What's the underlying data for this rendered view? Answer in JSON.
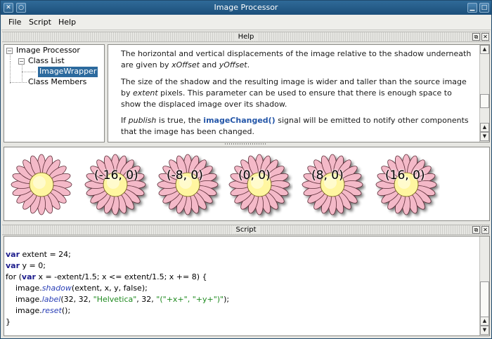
{
  "window": {
    "title": "Image Processor"
  },
  "menu": {
    "file": "File",
    "script": "Script",
    "help": "Help"
  },
  "help_dock": {
    "title": "Help",
    "tree": {
      "root": "Image Processor",
      "class_list": "Class List",
      "selected": "ImageWrapper",
      "class_members": "Class Members"
    },
    "paragraphs": {
      "p1_a": "The horizontal and vertical displacements of the image relative to the shadow underneath are given by ",
      "p1_x": "xOffset",
      "p1_and": " and ",
      "p1_y": "yOffset",
      "p1_end": ".",
      "p2_a": "The size of the shadow and the resulting image is wider and taller than the source image by ",
      "p2_ext": "extent",
      "p2_b": " pixels. This parameter can be used to ensure that there is enough space to show the displaced image over its shadow.",
      "p3_a": "If ",
      "p3_pub": "publish",
      "p3_b": " is true, the ",
      "p3_link": "imageChanged()",
      "p3_c": " signal will be emitted to notify other components that the image has been changed."
    }
  },
  "images": {
    "labels": [
      "(-16, 0)",
      "(-8, 0)",
      "(0, 0)",
      "(8, 0)",
      "(16, 0)"
    ],
    "petal_color": "#f4b9c8",
    "center_color": "#fff6a0"
  },
  "script_dock": {
    "title": "Script",
    "lines": {
      "l1_kw": "var",
      "l1_rest": " extent = 24;",
      "l2_kw": "var",
      "l2_rest": " y = 0;",
      "l3_a": "for (",
      "l3_kw": "var",
      "l3_rest": " x = -extent/1.5; x <= extent/1.5; x += 8) {",
      "l4_a": "    image.",
      "l4_fn": "shadow",
      "l4_b": "(extent, x, y, false);",
      "l5_a": "    image.",
      "l5_fn": "label",
      "l5_b": "(32, 32, ",
      "l5_str1": "\"Helvetica\"",
      "l5_c": ", 32, ",
      "l5_str2": "\"(\"+x+\", \"+y+\")\"",
      "l5_d": ");",
      "l6_a": "    image.",
      "l6_fn": "reset",
      "l6_b": "();",
      "l7": "}"
    }
  }
}
